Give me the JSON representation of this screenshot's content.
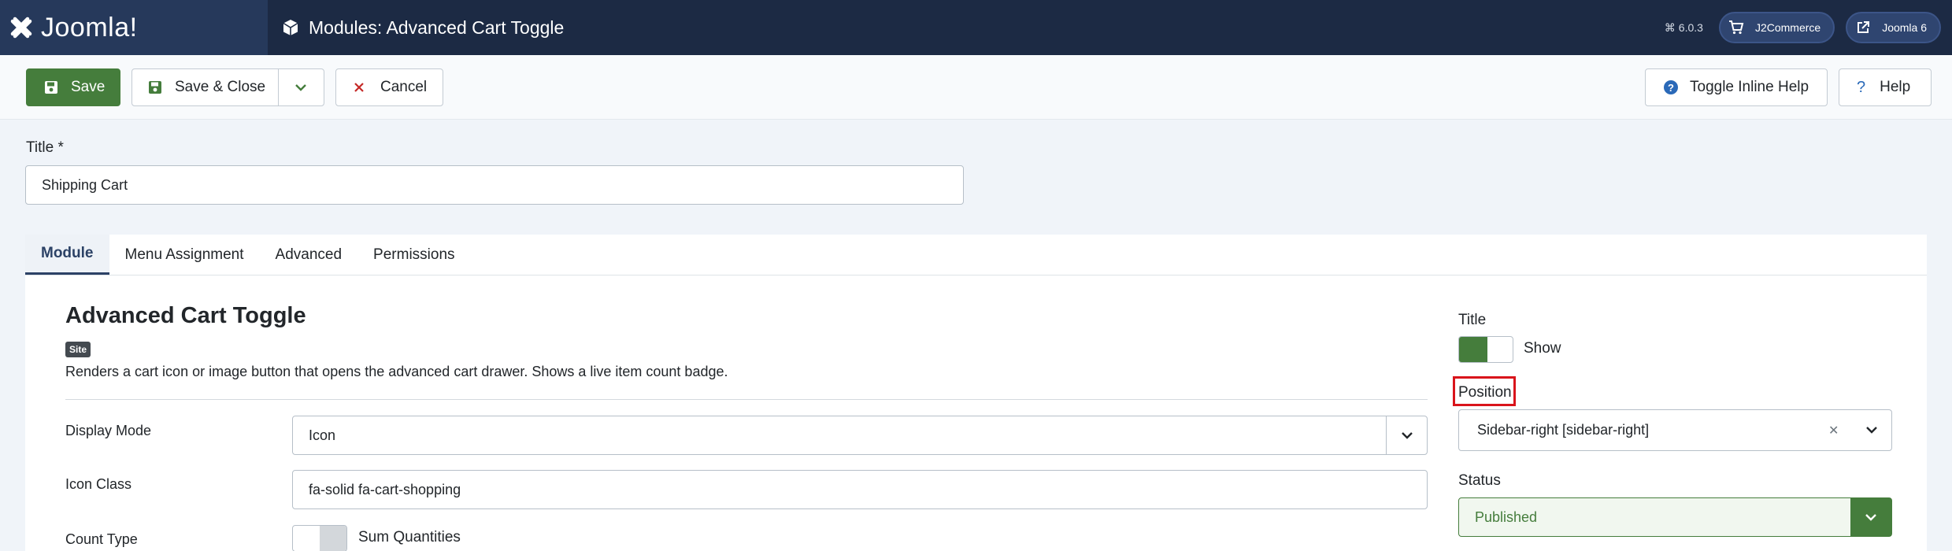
{
  "app": {
    "logo_text": "Joomla!",
    "page_title": "Modules: Advanced Cart Toggle",
    "version": "6.0.3",
    "header_links": [
      {
        "label": "J2Commerce",
        "icon": "cart-icon"
      },
      {
        "label": "Joomla 6",
        "icon": "external-link-icon"
      }
    ]
  },
  "toolbar": {
    "save_label": "Save",
    "save_close_label": "Save & Close",
    "cancel_label": "Cancel",
    "toggle_help_label": "Toggle Inline Help",
    "help_label": "Help"
  },
  "title_field": {
    "label": "Title *",
    "value": "Shipping Cart"
  },
  "tabs": [
    {
      "label": "Module",
      "active": true
    },
    {
      "label": "Menu Assignment",
      "active": false
    },
    {
      "label": "Advanced",
      "active": false
    },
    {
      "label": "Permissions",
      "active": false
    }
  ],
  "module": {
    "name": "Advanced Cart Toggle",
    "badge": "Site",
    "description": "Renders a cart icon or image button that opens the advanced cart drawer. Shows a live item count badge."
  },
  "fields": {
    "display_mode": {
      "label": "Display Mode",
      "value": "Icon"
    },
    "icon_class": {
      "label": "Icon Class",
      "value": "fa-solid fa-cart-shopping"
    },
    "count_type": {
      "label": "Count Type",
      "value": "Sum Quantities",
      "on": false
    }
  },
  "sidebar": {
    "title_label": "Title",
    "title_toggle": {
      "value": "Show",
      "on": true
    },
    "position_label": "Position",
    "position_value": "Sidebar-right [sidebar-right]",
    "status_label": "Status",
    "status_value": "Published"
  },
  "colors": {
    "header_bg": "#1c2a44",
    "success": "#457d3c",
    "highlight": "#d9141b"
  }
}
